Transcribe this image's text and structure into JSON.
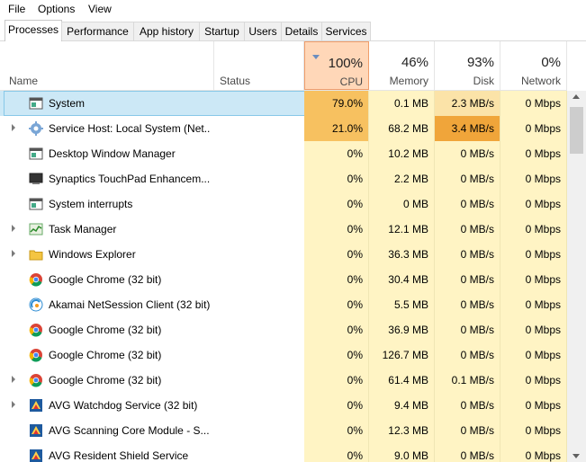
{
  "menu": [
    "File",
    "Options",
    "View"
  ],
  "tabs": [
    {
      "label": "Processes",
      "active": true
    },
    {
      "label": "Performance"
    },
    {
      "label": "App history"
    },
    {
      "label": "Startup"
    },
    {
      "label": "Users"
    },
    {
      "label": "Details"
    },
    {
      "label": "Services"
    }
  ],
  "columns": {
    "name": "Name",
    "status": "Status",
    "cpu": {
      "pct": "100%",
      "label": "CPU"
    },
    "memory": {
      "pct": "46%",
      "label": "Memory"
    },
    "disk": {
      "pct": "93%",
      "label": "Disk"
    },
    "network": {
      "pct": "0%",
      "label": "Network"
    }
  },
  "colors": {
    "heat_low": "#fff4c4",
    "heat_mid": "#fbe3a8",
    "heat_high": "#f7c160",
    "heat_max": "#f0a53a",
    "selected": "#cce8f6"
  },
  "rows": [
    {
      "name": "System",
      "icon": "window-icon",
      "expand": false,
      "cpu": "79.0%",
      "memory": "0.1 MB",
      "disk": "2.3 MB/s",
      "network": "0 Mbps",
      "selected": true,
      "cpu_heat": "high",
      "disk_heat": "mid"
    },
    {
      "name": "Service Host: Local System (Net...",
      "icon": "gear-icon",
      "expand": true,
      "cpu": "21.0%",
      "memory": "68.2 MB",
      "disk": "3.4 MB/s",
      "network": "0 Mbps",
      "cpu_heat": "high",
      "disk_heat": "max"
    },
    {
      "name": "Desktop Window Manager",
      "icon": "window-icon",
      "expand": false,
      "cpu": "0%",
      "memory": "10.2 MB",
      "disk": "0 MB/s",
      "network": "0 Mbps"
    },
    {
      "name": "Synaptics TouchPad Enhancem...",
      "icon": "touchpad-icon",
      "expand": false,
      "cpu": "0%",
      "memory": "2.2 MB",
      "disk": "0 MB/s",
      "network": "0 Mbps"
    },
    {
      "name": "System interrupts",
      "icon": "window-icon",
      "expand": false,
      "cpu": "0%",
      "memory": "0 MB",
      "disk": "0 MB/s",
      "network": "0 Mbps"
    },
    {
      "name": "Task Manager",
      "icon": "taskmanager-icon",
      "expand": true,
      "cpu": "0%",
      "memory": "12.1 MB",
      "disk": "0 MB/s",
      "network": "0 Mbps"
    },
    {
      "name": "Windows Explorer",
      "icon": "folder-icon",
      "expand": true,
      "cpu": "0%",
      "memory": "36.3 MB",
      "disk": "0 MB/s",
      "network": "0 Mbps"
    },
    {
      "name": "Google Chrome (32 bit)",
      "icon": "chrome-icon",
      "expand": false,
      "cpu": "0%",
      "memory": "30.4 MB",
      "disk": "0 MB/s",
      "network": "0 Mbps"
    },
    {
      "name": "Akamai NetSession Client (32 bit)",
      "icon": "akamai-icon",
      "expand": false,
      "cpu": "0%",
      "memory": "5.5 MB",
      "disk": "0 MB/s",
      "network": "0 Mbps"
    },
    {
      "name": "Google Chrome (32 bit)",
      "icon": "chrome-icon",
      "expand": false,
      "cpu": "0%",
      "memory": "36.9 MB",
      "disk": "0 MB/s",
      "network": "0 Mbps"
    },
    {
      "name": "Google Chrome (32 bit)",
      "icon": "chrome-icon",
      "expand": false,
      "cpu": "0%",
      "memory": "126.7 MB",
      "disk": "0 MB/s",
      "network": "0 Mbps"
    },
    {
      "name": "Google Chrome (32 bit)",
      "icon": "chrome-icon",
      "expand": true,
      "cpu": "0%",
      "memory": "61.4 MB",
      "disk": "0.1 MB/s",
      "network": "0 Mbps"
    },
    {
      "name": "AVG Watchdog Service (32 bit)",
      "icon": "avg-icon",
      "expand": true,
      "cpu": "0%",
      "memory": "9.4 MB",
      "disk": "0 MB/s",
      "network": "0 Mbps"
    },
    {
      "name": "AVG Scanning Core Module - S...",
      "icon": "avg-icon",
      "expand": false,
      "cpu": "0%",
      "memory": "12.3 MB",
      "disk": "0 MB/s",
      "network": "0 Mbps"
    },
    {
      "name": "AVG Resident Shield Service",
      "icon": "avg-icon",
      "expand": false,
      "cpu": "0%",
      "memory": "9.0 MB",
      "disk": "0 MB/s",
      "network": "0 Mbps"
    }
  ]
}
